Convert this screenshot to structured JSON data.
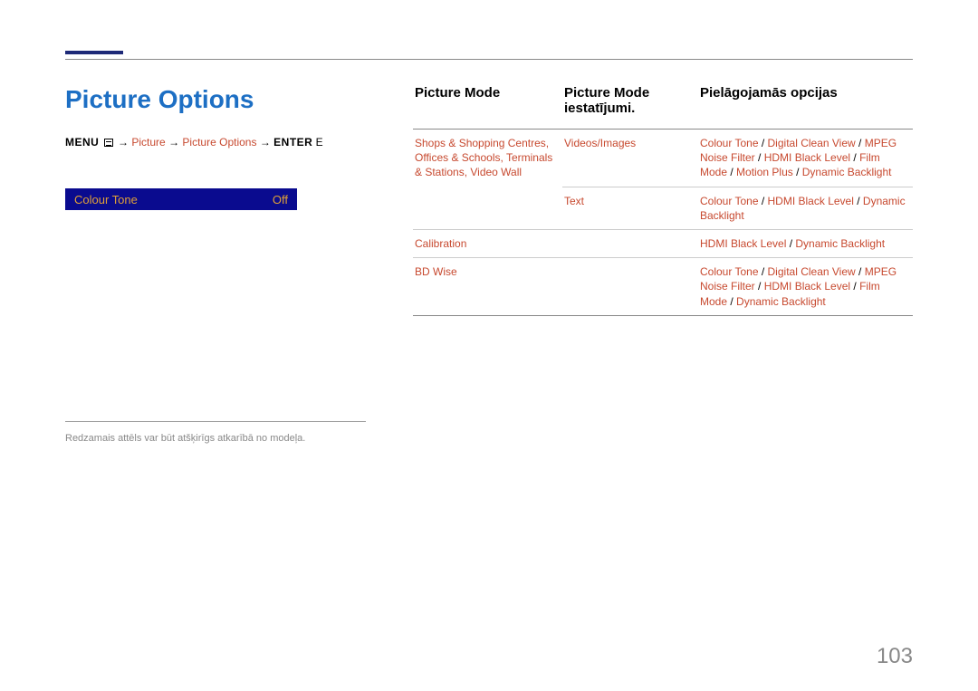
{
  "title": "Picture Options",
  "breadcrumb": {
    "menu": "MENU",
    "p1": "Picture",
    "p2": "Picture Options",
    "enter": "ENTER",
    "enter_suffix": "E"
  },
  "osd": {
    "name": "Colour Tone",
    "value": "Off"
  },
  "footnote": "Redzamais attēls var būt atšķirīgs atkarībā no modeļa.",
  "pageno": "103",
  "table": {
    "headers": {
      "h1": "Picture Mode",
      "h2": "Picture Mode iestatījumi.",
      "h3": "Pielāgojamās opcijas"
    },
    "rows": [
      {
        "c1": "Shops & Shopping Centres, Offices & Schools, Terminals & Stations, Video Wall",
        "c2": "Videos/Images",
        "c3": [
          "Colour Tone",
          "Digital Clean View",
          "MPEG Noise Filter",
          "HDMI Black Level",
          "Film Mode",
          "Motion Plus",
          "Dynamic Backlight"
        ]
      },
      {
        "c1": "",
        "c2": "Text",
        "c3": [
          "Colour Tone",
          "HDMI Black Level",
          "Dynamic Backlight"
        ]
      },
      {
        "c1": "Calibration",
        "c2": "",
        "c3": [
          "HDMI Black Level",
          "Dynamic Backlight"
        ]
      },
      {
        "c1": "BD Wise",
        "c2": "",
        "c3": [
          "Colour Tone",
          "Digital Clean View",
          "MPEG Noise Filter",
          "HDMI Black Level",
          "Film Mode",
          "Dynamic Backlight"
        ]
      }
    ]
  }
}
